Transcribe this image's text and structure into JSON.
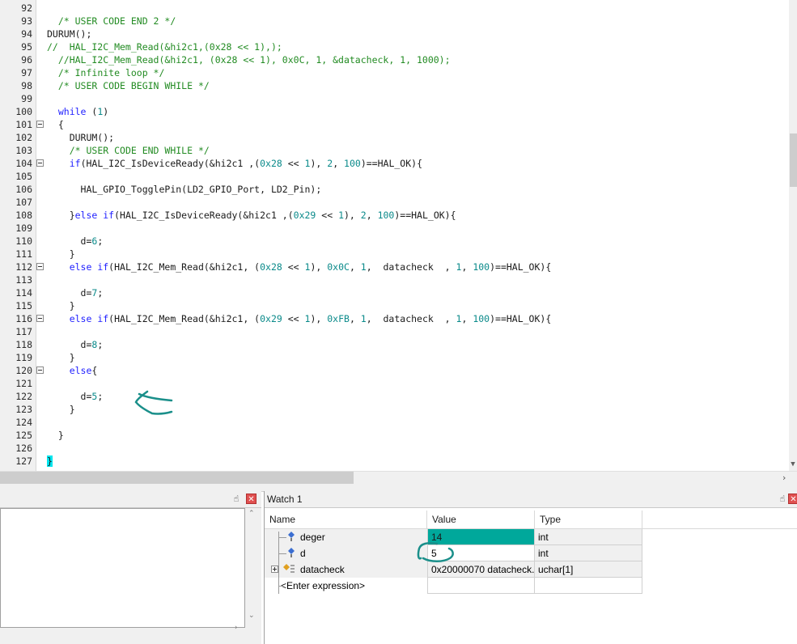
{
  "editor": {
    "lines": [
      {
        "n": "92",
        "html": ""
      },
      {
        "n": "93",
        "html": "  <span class=\"cm\">/* USER CODE END 2 */</span>"
      },
      {
        "n": "94",
        "html": "DURUM();"
      },
      {
        "n": "95",
        "html": "<span class=\"cm\">//  HAL_I2C_Mem_Read(&amp;hi2c1,(0x28 &lt;&lt; 1),);</span>"
      },
      {
        "n": "96",
        "html": "  <span class=\"cm\">//HAL_I2C_Mem_Read(&amp;hi2c1, (0x28 &lt;&lt; 1), 0x0C, 1, &amp;datacheck, 1, 1000);</span>"
      },
      {
        "n": "97",
        "html": "  <span class=\"cm\">/* Infinite loop */</span>"
      },
      {
        "n": "98",
        "html": "  <span class=\"cm\">/* USER CODE BEGIN WHILE */</span>"
      },
      {
        "n": "99",
        "html": ""
      },
      {
        "n": "100",
        "html": "  <span class=\"kw\">while</span> (<span class=\"num\">1</span>)"
      },
      {
        "n": "101",
        "html": "  {",
        "fold": true
      },
      {
        "n": "102",
        "html": "    DURUM();"
      },
      {
        "n": "103",
        "html": "    <span class=\"cm\">/* USER CODE END WHILE */</span>"
      },
      {
        "n": "104",
        "html": "    <span class=\"kw\">if</span>(HAL_I2C_IsDeviceReady(&amp;hi2c1 ,(<span class=\"num\">0x28</span> &lt;&lt; <span class=\"num\">1</span>), <span class=\"num\">2</span>, <span class=\"num\">100</span>)==HAL_OK){",
        "fold": true
      },
      {
        "n": "105",
        "html": ""
      },
      {
        "n": "106",
        "html": "      HAL_GPIO_TogglePin(LD2_GPIO_Port, LD2_Pin);"
      },
      {
        "n": "107",
        "html": ""
      },
      {
        "n": "108",
        "html": "    }<span class=\"kw\">else if</span>(HAL_I2C_IsDeviceReady(&amp;hi2c1 ,(<span class=\"num\">0x29</span> &lt;&lt; <span class=\"num\">1</span>), <span class=\"num\">2</span>, <span class=\"num\">100</span>)==HAL_OK){"
      },
      {
        "n": "109",
        "html": ""
      },
      {
        "n": "110",
        "html": "      d=<span class=\"num\">6</span>;"
      },
      {
        "n": "111",
        "html": "    }"
      },
      {
        "n": "112",
        "html": "    <span class=\"kw\">else if</span>(HAL_I2C_Mem_Read(&amp;hi2c1, (<span class=\"num\">0x28</span> &lt;&lt; <span class=\"num\">1</span>), <span class=\"num\">0x0C</span>, <span class=\"num\">1</span>,  datacheck  , <span class=\"num\">1</span>, <span class=\"num\">100</span>)==HAL_OK){",
        "fold": true
      },
      {
        "n": "113",
        "html": ""
      },
      {
        "n": "114",
        "html": "      d=<span class=\"num\">7</span>;"
      },
      {
        "n": "115",
        "html": "    }"
      },
      {
        "n": "116",
        "html": "    <span class=\"kw\">else if</span>(HAL_I2C_Mem_Read(&amp;hi2c1, (<span class=\"num\">0x29</span> &lt;&lt; <span class=\"num\">1</span>), <span class=\"num\">0xFB</span>, <span class=\"num\">1</span>,  datacheck  , <span class=\"num\">1</span>, <span class=\"num\">100</span>)==HAL_OK){",
        "fold": true
      },
      {
        "n": "117",
        "html": ""
      },
      {
        "n": "118",
        "html": "      d=<span class=\"num\">8</span>;"
      },
      {
        "n": "119",
        "html": "    }"
      },
      {
        "n": "120",
        "html": "    <span class=\"kw\">else</span>{",
        "fold": true
      },
      {
        "n": "121",
        "html": ""
      },
      {
        "n": "122",
        "html": "      d=<span class=\"num\">5</span>;"
      },
      {
        "n": "123",
        "html": "    }"
      },
      {
        "n": "124",
        "html": ""
      },
      {
        "n": "125",
        "html": "  }"
      },
      {
        "n": "126",
        "html": ""
      },
      {
        "n": "127",
        "html": "<span class=\"brace-hl\">}</span>"
      }
    ]
  },
  "left_panel": {
    "pin_icon": "pin-icon",
    "close_icon": "close-icon"
  },
  "watch": {
    "title": "Watch 1",
    "columns": {
      "name": "Name",
      "value": "Value",
      "type": "Type"
    },
    "rows": [
      {
        "name": "deger",
        "value": "14",
        "type": "int",
        "highlight": true
      },
      {
        "name": "d",
        "value": "5",
        "type": "int"
      },
      {
        "name": "datacheck",
        "value": "0x20000070 datacheck...",
        "type": "uchar[1]",
        "expandable": true
      },
      {
        "name": "<Enter expression>",
        "value": "",
        "type": ""
      }
    ]
  },
  "colors": {
    "accent_teal": "#00a89b",
    "annotation": "#1a8f8a",
    "brace_highlight": "#00e5ee",
    "comment": "#228b22",
    "keyword": "#1f1fff"
  }
}
